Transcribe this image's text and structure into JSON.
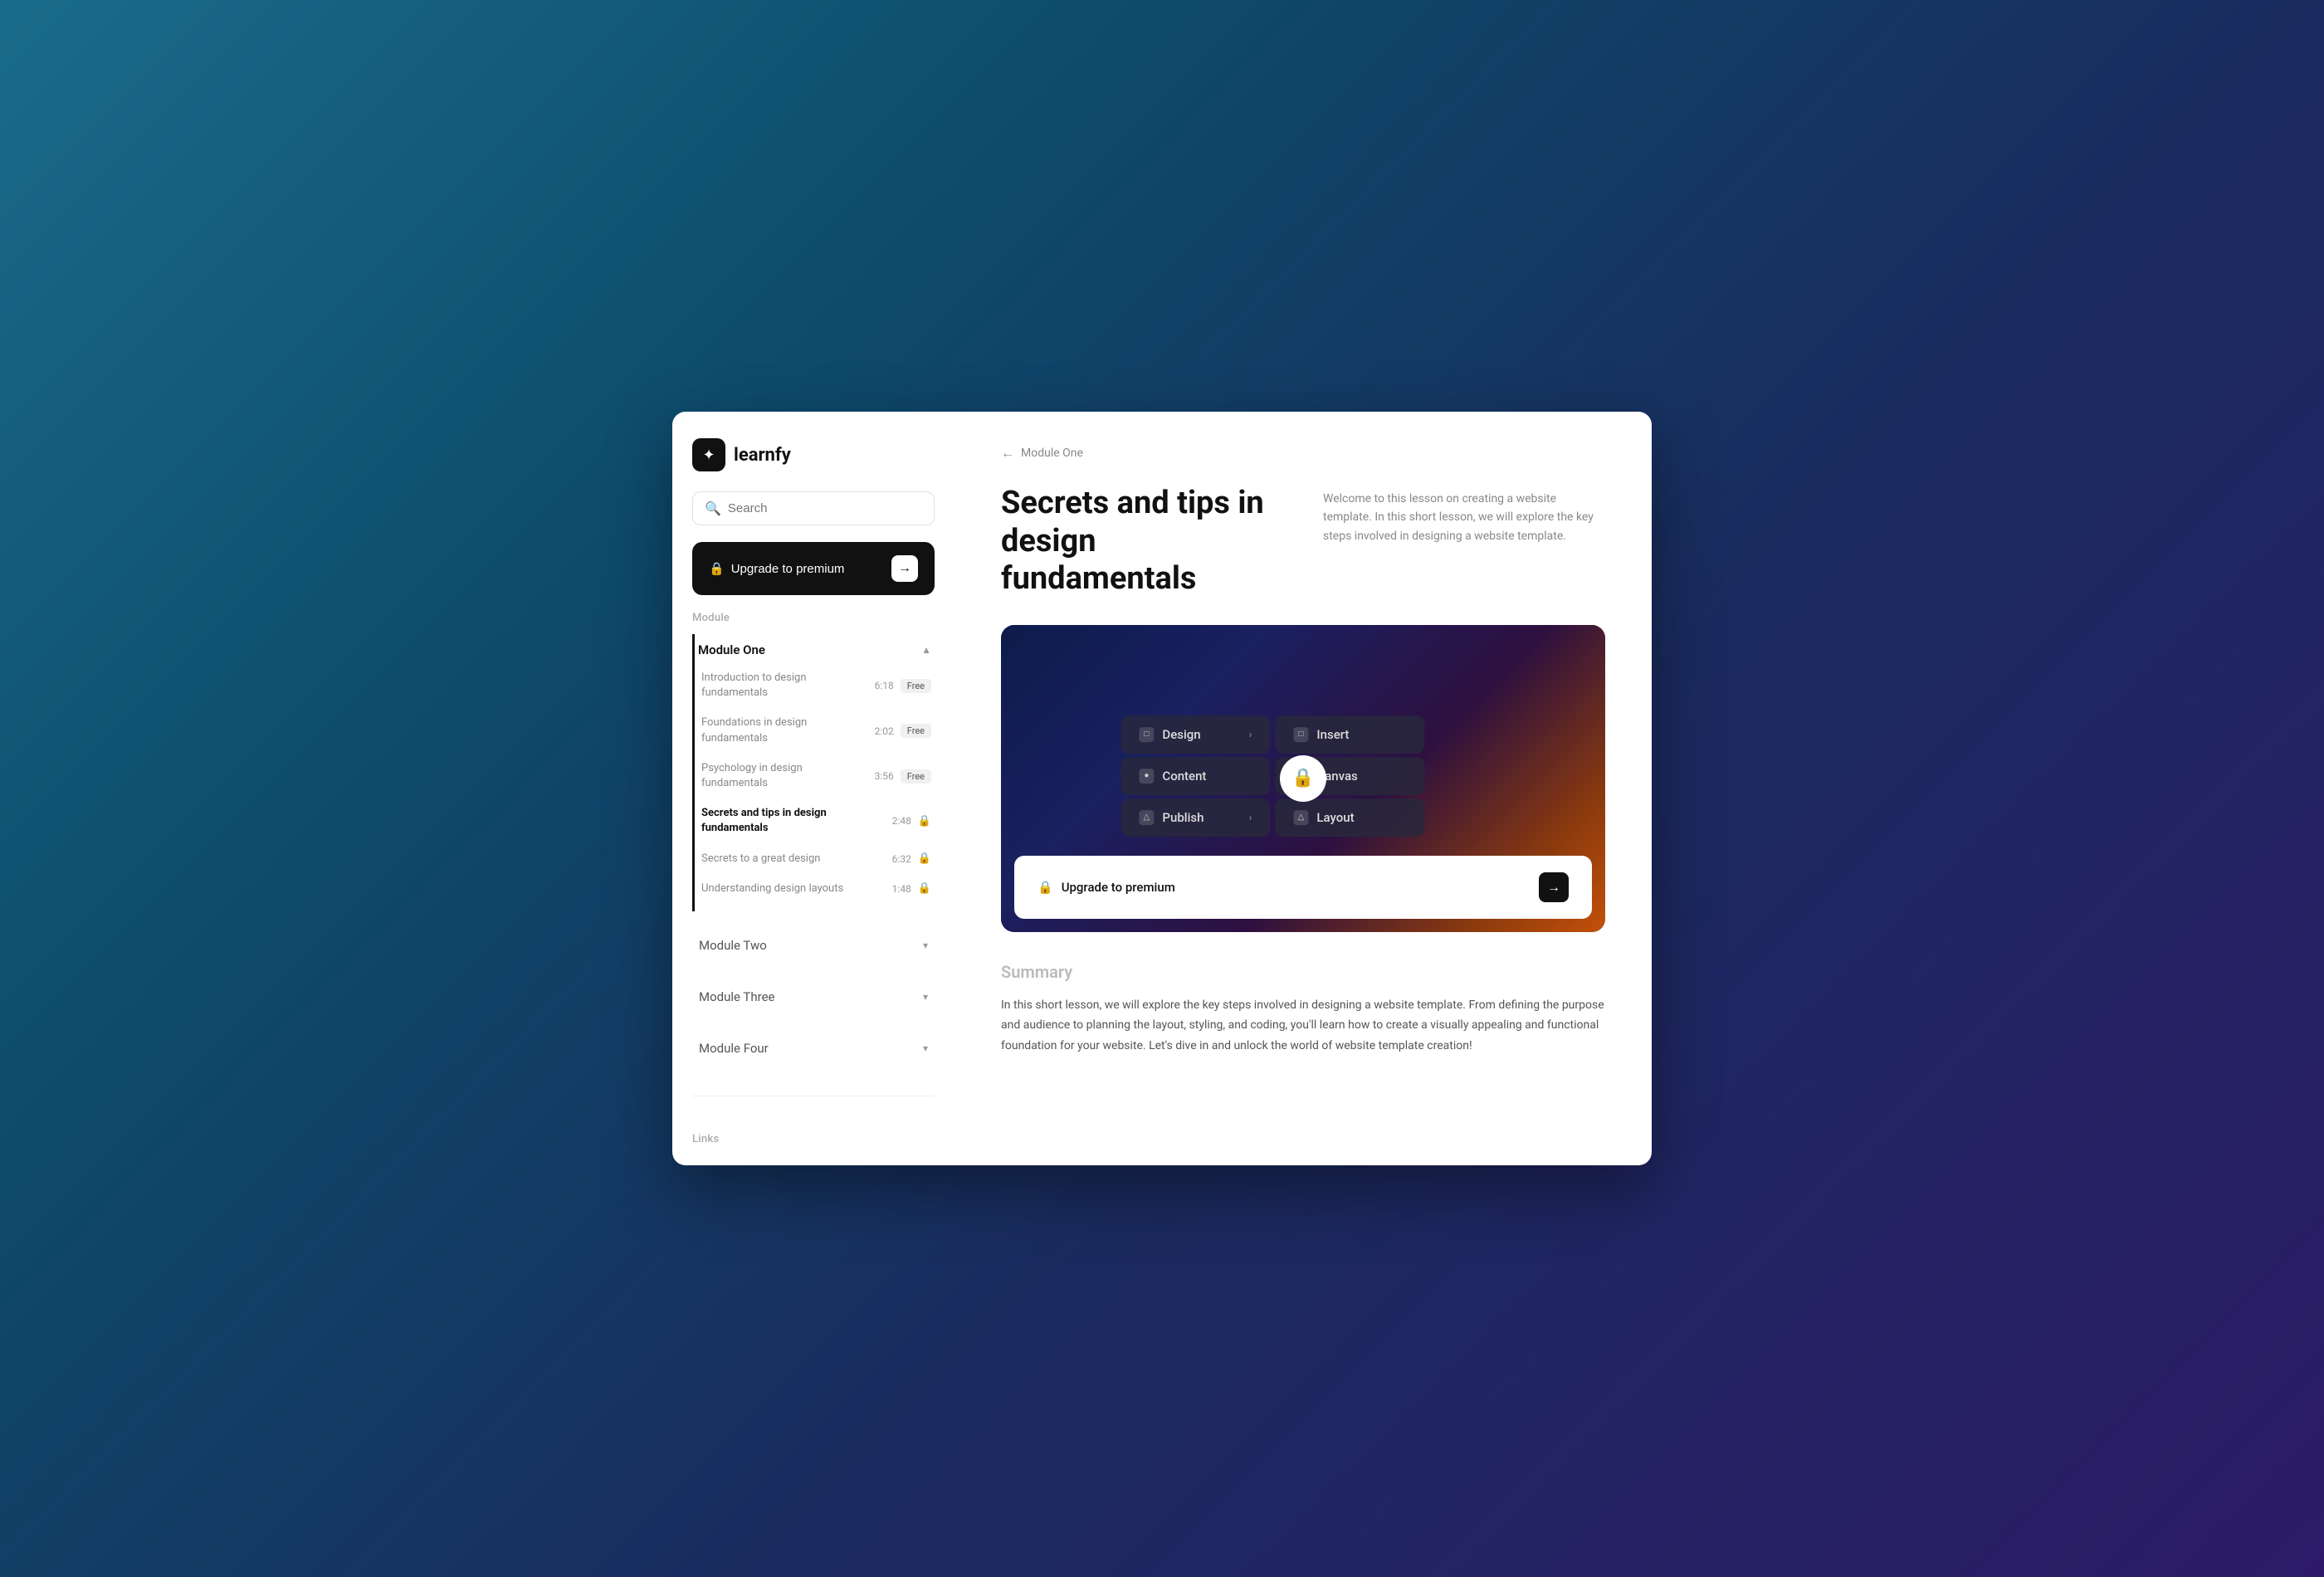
{
  "app": {
    "logo_icon": "✦",
    "logo_name": "learnfy"
  },
  "sidebar": {
    "search_placeholder": "Search",
    "upgrade_label": "Upgrade to premium",
    "module_section_label": "Module",
    "modules": [
      {
        "id": "module-one",
        "label": "Module One",
        "expanded": true,
        "active": true,
        "lessons": [
          {
            "id": "intro-design",
            "title": "Introduction to design fundamentals",
            "duration": "6:18",
            "access": "free",
            "active": false
          },
          {
            "id": "foundations-design",
            "title": "Foundations in design fundamentals",
            "duration": "2:02",
            "access": "free",
            "active": false
          },
          {
            "id": "psychology-design",
            "title": "Psychology in design fundamentals",
            "duration": "3:56",
            "access": "free",
            "active": false
          },
          {
            "id": "secrets-tips",
            "title": "Secrets and tips in design fundamentals",
            "duration": "2:48",
            "access": "locked",
            "active": true
          },
          {
            "id": "secrets-great",
            "title": "Secrets to a great design",
            "duration": "6:32",
            "access": "locked",
            "active": false
          },
          {
            "id": "understanding-layouts",
            "title": "Understanding design layouts",
            "duration": "1:48",
            "access": "locked",
            "active": false
          }
        ]
      },
      {
        "id": "module-two",
        "label": "Module Two",
        "expanded": false
      },
      {
        "id": "module-three",
        "label": "Module Three",
        "expanded": false
      },
      {
        "id": "module-four",
        "label": "Module Four",
        "expanded": false
      }
    ],
    "links_label": "Links"
  },
  "main": {
    "breadcrumb_arrow": "←",
    "breadcrumb_label": "Module One",
    "page_title": "Secrets and tips in design fundamentals",
    "page_description": "Welcome to this lesson on creating a website template. In this short lesson, we will explore the key steps involved in designing a website template.",
    "video": {
      "menu_items": [
        {
          "icon": "□",
          "label": "Design",
          "has_arrow": true
        },
        {
          "icon": "●",
          "label": "Content",
          "has_arrow": false
        },
        {
          "icon": "△",
          "label": "Publish",
          "has_arrow": true
        },
        {
          "icon": "□",
          "label": "Insert",
          "has_arrow": false
        },
        {
          "icon": "○",
          "label": "Canvas",
          "has_arrow": false
        },
        {
          "icon": "△",
          "label": "Layout",
          "has_arrow": false
        }
      ],
      "lock_symbol": "🔒",
      "upgrade_label": "Upgrade to premium",
      "upgrade_arrow": "→"
    },
    "summary": {
      "title": "Summary",
      "text": "In this short lesson, we will explore the key steps involved in designing a website template. From defining the purpose and audience to planning the layout, styling, and coding, you'll learn how to create a visually appealing and functional foundation for your website. Let's dive in and unlock the world of website template creation!"
    }
  }
}
